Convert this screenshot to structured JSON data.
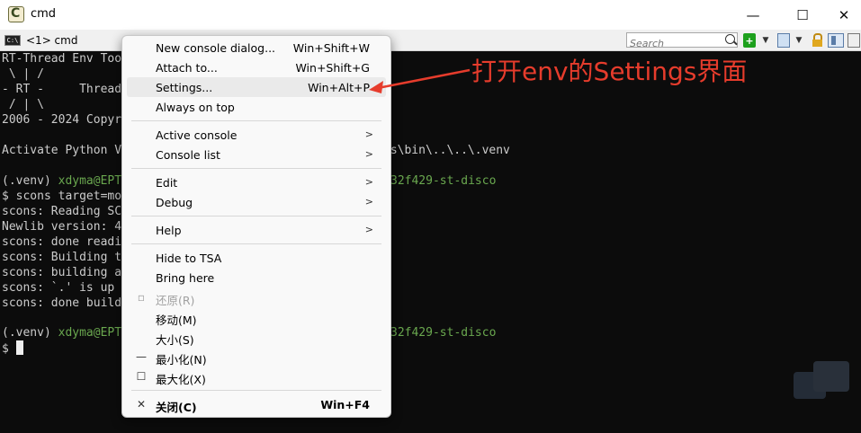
{
  "window": {
    "title": "cmd",
    "controls": {
      "minimize": "—",
      "maximize": "☐",
      "close": "✕"
    }
  },
  "tabbar": {
    "tab_label": "<1> cmd",
    "tab_icon_text": "C:\\",
    "search_placeholder": "Search",
    "add_label": "+",
    "dropdown_glyph": "▼"
  },
  "console": {
    "lines": [
      "RT-Thread Env Too",
      " \\ | /",
      "- RT -     Thread",
      " / | \\",
      "2006 - 2024 Copyr",
      "",
      "Activate Python V",
      "",
      "(.venv) xdyma@EPT",
      "$ scons target=mo",
      "scons: Reading SC",
      "Newlib version: 4",
      "scons: done readi",
      "scons: Building t",
      "scons: building a",
      "scons: `.' is up",
      "scons: done build",
      "",
      "(.venv) xdyma@EPT",
      "$ "
    ],
    "right_fragments": {
      "venv_path": "ls\\bin\\..\\..\\.venv",
      "board1": "32f429-st-disco",
      "board2": "32f429-st-disco"
    },
    "prompt_user": "xdyma@EPT",
    "prompt_env": "(.venv) "
  },
  "menu": {
    "items": [
      {
        "label": "New console dialog...",
        "shortcut": "Win+Shift+W"
      },
      {
        "label": "Attach to...",
        "shortcut": "Win+Shift+G"
      },
      {
        "label": "Settings...",
        "shortcut": "Win+Alt+P"
      },
      {
        "label": "Always on top",
        "shortcut": ""
      },
      {
        "label": "Active console",
        "shortcut": ""
      },
      {
        "label": "Console list",
        "shortcut": ""
      },
      {
        "label": "Edit",
        "shortcut": ""
      },
      {
        "label": "Debug",
        "shortcut": ""
      },
      {
        "label": "Help",
        "shortcut": ""
      },
      {
        "label": "Hide to TSA",
        "shortcut": ""
      },
      {
        "label": "Bring here",
        "shortcut": ""
      },
      {
        "label": "还原(R)",
        "shortcut": ""
      },
      {
        "label": "移动(M)",
        "shortcut": ""
      },
      {
        "label": "大小(S)",
        "shortcut": ""
      },
      {
        "label": "最小化(N)",
        "shortcut": ""
      },
      {
        "label": "最大化(X)",
        "shortcut": ""
      },
      {
        "label": "关闭(C)",
        "shortcut": "Win+F4"
      }
    ],
    "submenu_arrow": ">",
    "icons": {
      "restore": "▫",
      "minimize": "—",
      "maximize": "☐",
      "close": "✕"
    }
  },
  "annotation": {
    "text": "打开env的Settings界面",
    "color": "#e63c2c"
  },
  "colors": {
    "console_bg": "#0c0c0c",
    "console_fg": "#cccccc",
    "prompt_green": "#6aa84f",
    "annotation_red": "#e63c2c"
  }
}
